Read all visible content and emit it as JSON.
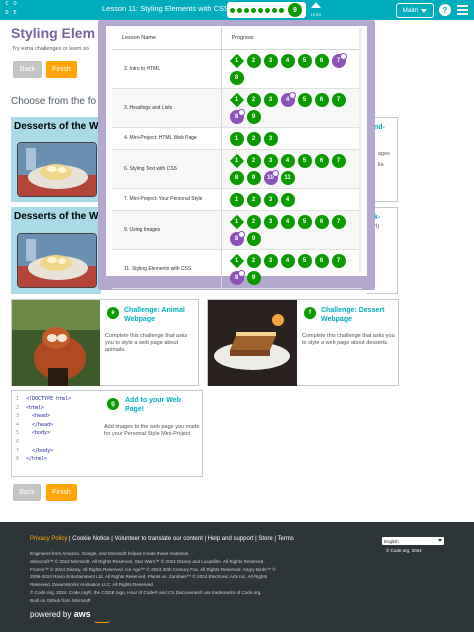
{
  "header": {
    "logo_letters": [
      "C",
      "O",
      "D",
      "E",
      "",
      ""
    ],
    "lesson_title": "Lesson 11: Styling Elements with CSS",
    "current_level": "9",
    "less_label": "LESS",
    "user_name": "Maitri",
    "help_label": "?"
  },
  "page": {
    "title": "Styling Elem",
    "subtitle": "Try extra challenges or learn so",
    "back_label": "Back",
    "finish_label": "Finish",
    "choose_heading": "Choose from the fo"
  },
  "cards": [
    {
      "title": "Desserts of the W",
      "right_title": "nd-",
      "right_snippet": "ages",
      "right_snippet2": "lia"
    },
    {
      "title": "Desserts of the W",
      "right_title": "k-",
      "right_snippet": "rl)"
    }
  ],
  "challenges": [
    {
      "badge": "e",
      "title": "Challenge: Animal Webpage",
      "desc": "Complete this challenge that asks you to style a web page about animals."
    },
    {
      "badge": "f",
      "title": "Challenge: Dessert Webpage",
      "desc": "Complete this challenge that asks you to style a web page about desserts."
    },
    {
      "badge": "g",
      "title": "Add to your Web Page!",
      "desc": "Add images to the web page you made for your Personal Style Mini-Project"
    }
  ],
  "code_lines": [
    {
      "n": "1",
      "t": "<!DOCTYPE html>"
    },
    {
      "n": "2",
      "t": "<html>"
    },
    {
      "n": "3",
      "t": "  <head>"
    },
    {
      "n": "4",
      "t": "  </head>"
    },
    {
      "n": "5",
      "t": "  <body>"
    },
    {
      "n": "6",
      "t": ""
    },
    {
      "n": "7",
      "t": "  </body>"
    },
    {
      "n": "8",
      "t": "</html>"
    }
  ],
  "progress_table": {
    "col_lesson": "Lesson Name",
    "col_progress": "Progress",
    "rows": [
      {
        "name": "2. Intro to HTML",
        "bubbles": [
          {
            "l": "1",
            "s": "dia"
          },
          {
            "l": "2",
            "s": "g"
          },
          {
            "l": "3",
            "s": "g"
          },
          {
            "l": "4",
            "s": "g"
          },
          {
            "l": "5",
            "s": "g"
          },
          {
            "l": "6",
            "s": "g"
          },
          {
            "l": "7",
            "s": "p"
          },
          {
            "l": "8",
            "s": "g"
          }
        ]
      },
      {
        "name": "3. Headings and Lists",
        "bubbles": [
          {
            "l": "1",
            "s": "dia"
          },
          {
            "l": "2",
            "s": "g"
          },
          {
            "l": "3",
            "s": "g"
          },
          {
            "l": "4",
            "s": "p"
          },
          {
            "l": "5",
            "s": "g"
          },
          {
            "l": "6",
            "s": "g"
          },
          {
            "l": "7",
            "s": "g"
          },
          {
            "l": "8",
            "s": "p"
          },
          {
            "l": "9",
            "s": "g"
          }
        ]
      },
      {
        "name": "4. Mini-Project: HTML Web Page",
        "bubbles": [
          {
            "l": "1",
            "s": "g"
          },
          {
            "l": "2",
            "s": "g"
          },
          {
            "l": "3",
            "s": "g"
          }
        ]
      },
      {
        "name": "6. Styling Text with CSS",
        "bubbles": [
          {
            "l": "1",
            "s": "dia"
          },
          {
            "l": "2",
            "s": "g"
          },
          {
            "l": "3",
            "s": "g"
          },
          {
            "l": "4",
            "s": "g"
          },
          {
            "l": "5",
            "s": "g"
          },
          {
            "l": "6",
            "s": "g"
          },
          {
            "l": "7",
            "s": "g"
          },
          {
            "l": "8",
            "s": "g"
          },
          {
            "l": "9",
            "s": "g"
          },
          {
            "l": "10",
            "s": "p"
          },
          {
            "l": "11",
            "s": "g"
          }
        ]
      },
      {
        "name": "7. Mini-Project: Your Personal Style",
        "bubbles": [
          {
            "l": "1",
            "s": "g"
          },
          {
            "l": "2",
            "s": "g"
          },
          {
            "l": "3",
            "s": "g"
          },
          {
            "l": "4",
            "s": "g"
          }
        ]
      },
      {
        "name": "9. Using Images",
        "bubbles": [
          {
            "l": "1",
            "s": "dia"
          },
          {
            "l": "2",
            "s": "g"
          },
          {
            "l": "3",
            "s": "g"
          },
          {
            "l": "4",
            "s": "g"
          },
          {
            "l": "5",
            "s": "g"
          },
          {
            "l": "6",
            "s": "g"
          },
          {
            "l": "7",
            "s": "g"
          },
          {
            "l": "8",
            "s": "p"
          },
          {
            "l": "9",
            "s": "g"
          }
        ]
      },
      {
        "name": "11. Styling Elements with CSS",
        "bubbles": [
          {
            "l": "1",
            "s": "dia"
          },
          {
            "l": "2",
            "s": "g"
          },
          {
            "l": "3",
            "s": "g"
          },
          {
            "l": "4",
            "s": "g"
          },
          {
            "l": "5",
            "s": "g"
          },
          {
            "l": "6",
            "s": "g"
          },
          {
            "l": "7",
            "s": "g"
          },
          {
            "l": "8",
            "s": "p"
          },
          {
            "l": "9",
            "s": "g"
          }
        ]
      }
    ]
  },
  "footer": {
    "privacy": "Privacy Policy",
    "links_rest": " | Cookie Notice | Volunteer to translate our content | Help and support | Store | Terms",
    "language": "English",
    "copyright": "© Code.org, 2024",
    "legal": [
      "Engineers from Amazon, Google, and Microsoft helped create these materials.",
      "Minecraft™ © 2024 Microsoft. All Rights Reserved. Star Wars™ © 2024 Disney and Lucasfilm. All Rights Reserved.",
      "Frozen™ © 2024 Disney. All Rights Reserved. Ice Age™ © 2024 20th Century Fox. All Rights Reserved. Angry Birds™ ©",
      "2009-2024 Rovio Entertainment Ltd. All Rights Reserved. Plants vs. Zombies™ © 2024 Electronic Arts Inc. All Rights",
      "Reserved. DreamWorks Animation LLC. All Rights Reserved.",
      "© Code.org, 2024. Code.org®, the CODE logo, Hour of Code® and CS Discoveries® are trademarks of Code.org.",
      "Built on Github from Microsoft"
    ],
    "aws_prefix": "powered by",
    "aws_brand": "aws"
  },
  "colors": {
    "accent": "#00adbc",
    "title_purple": "#7665a0",
    "green": "#0b9900",
    "purple": "#8c52ba",
    "orange": "#ffa400",
    "footer_bg": "#2e3538"
  }
}
